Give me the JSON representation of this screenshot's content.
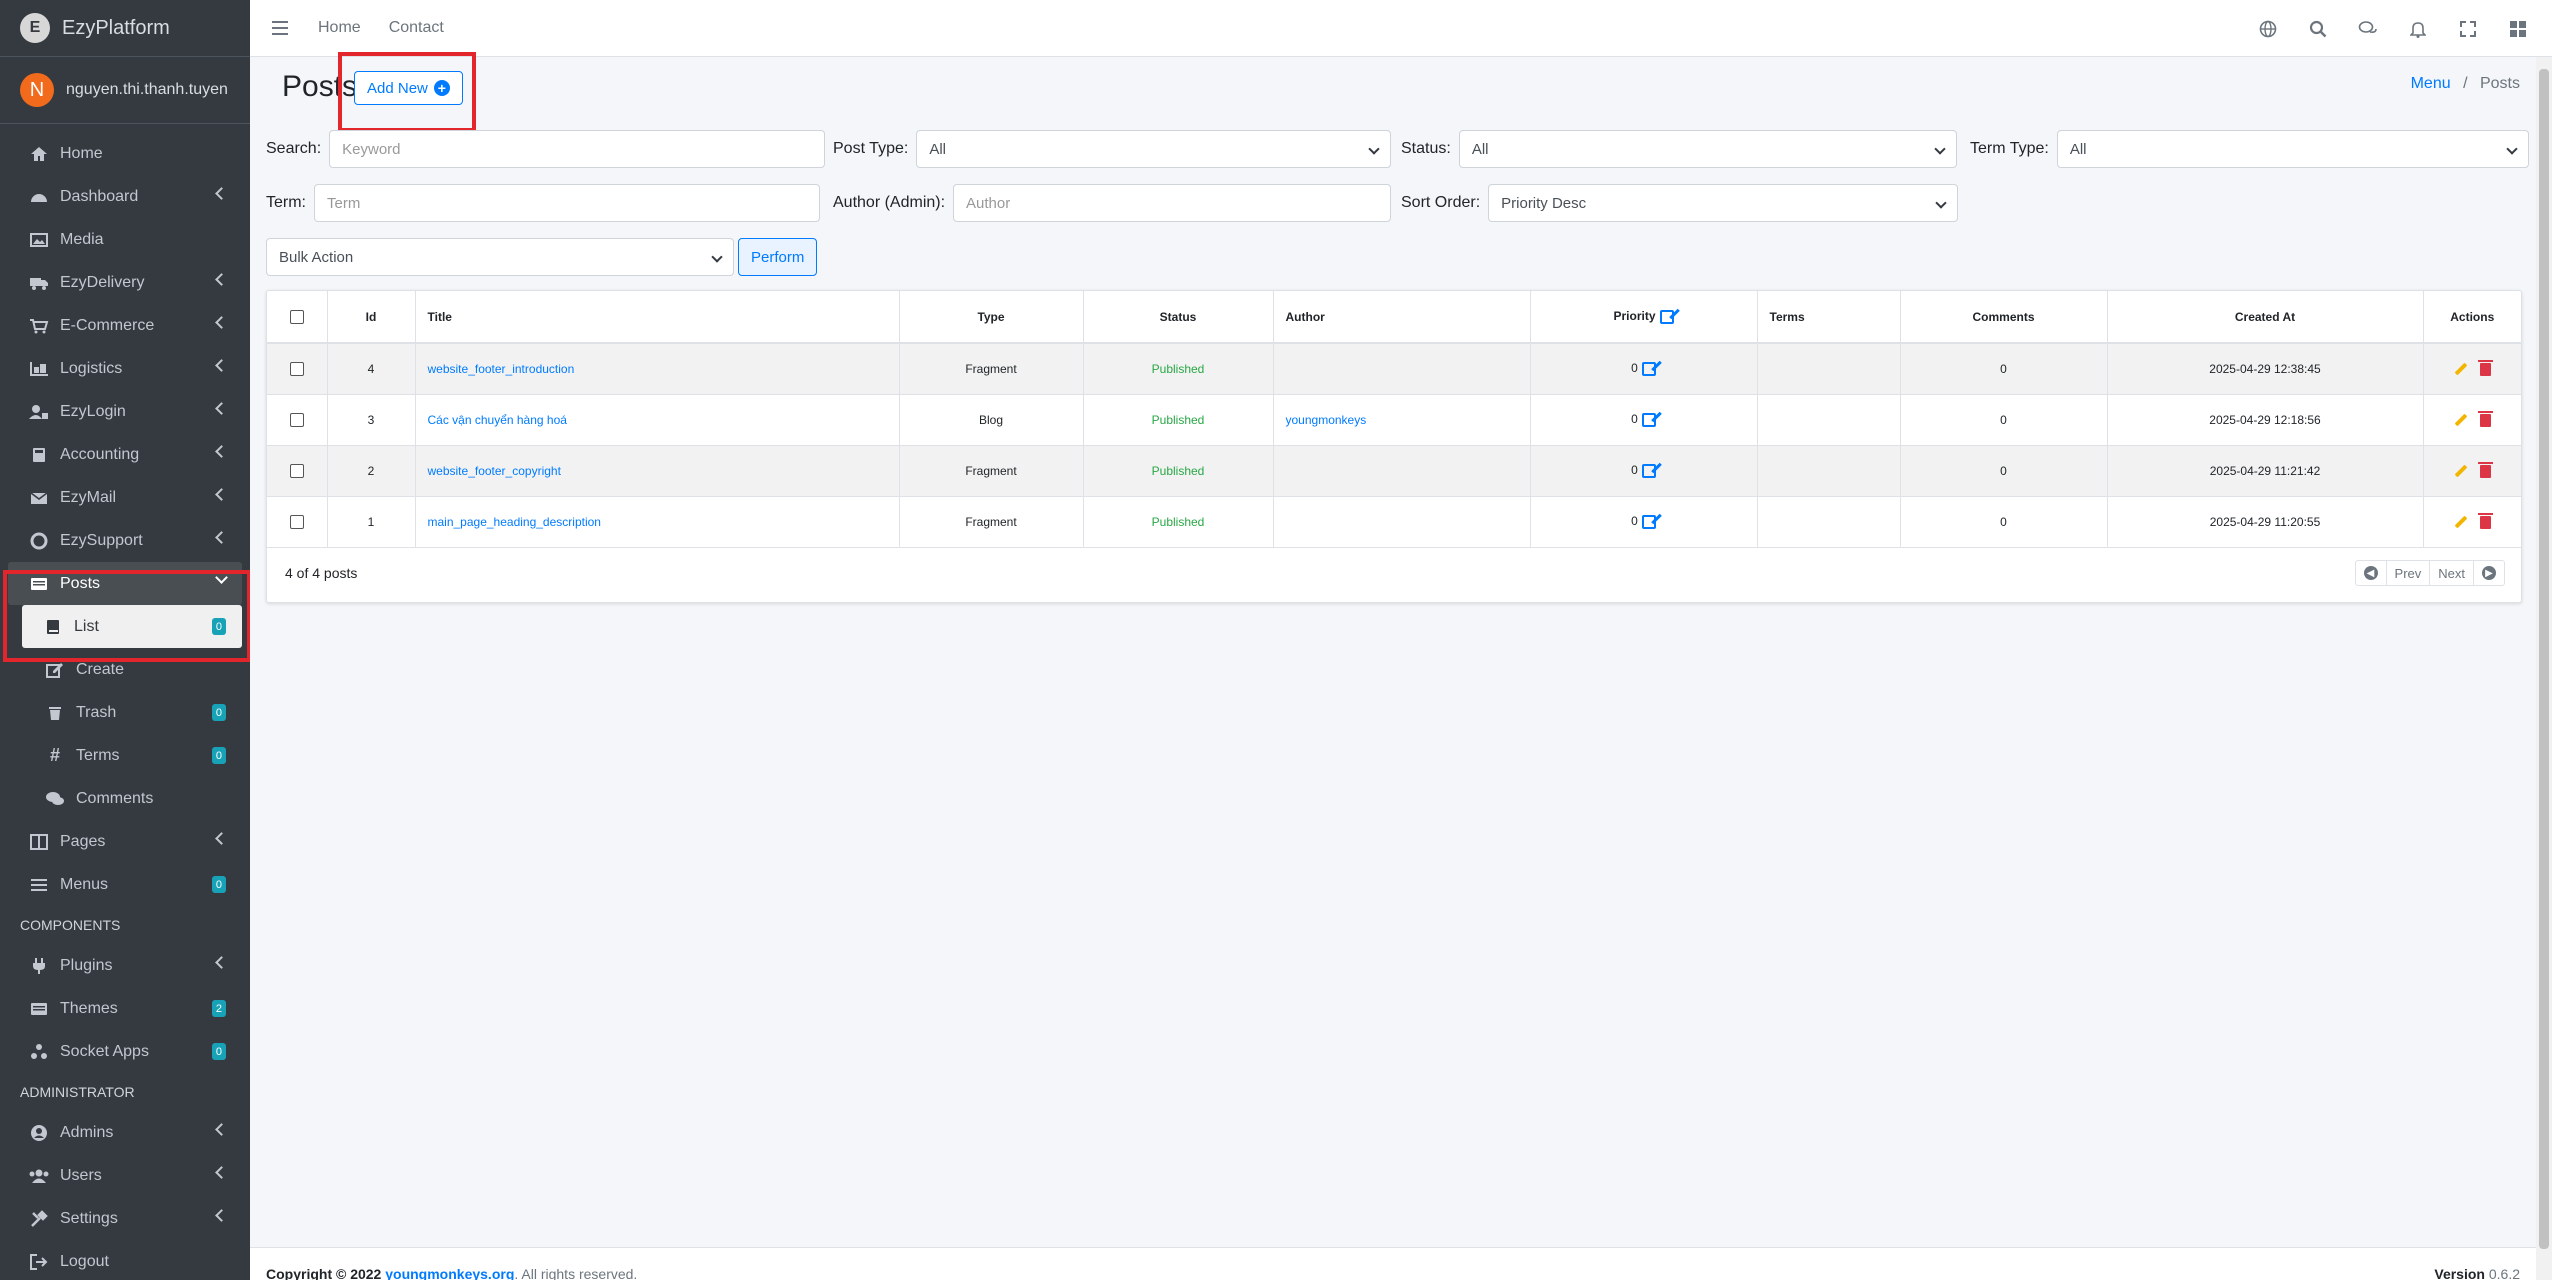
{
  "brand": {
    "logo_letter": "E",
    "name": "EzyPlatform"
  },
  "user": {
    "initial": "N",
    "name": "nguyen.thi.thanh.tuyen"
  },
  "sidebar": {
    "items": [
      {
        "label": "Home",
        "icon": "home-icon"
      },
      {
        "label": "Dashboard",
        "icon": "dashboard-icon"
      },
      {
        "label": "Media",
        "icon": "image-icon"
      },
      {
        "label": "EzyDelivery",
        "icon": "truck-icon"
      },
      {
        "label": "E-Commerce",
        "icon": "cart-icon"
      },
      {
        "label": "Logistics",
        "icon": "warehouse-icon"
      },
      {
        "label": "EzyLogin",
        "icon": "user-lock-icon"
      },
      {
        "label": "Accounting",
        "icon": "calculator-icon"
      },
      {
        "label": "EzyMail",
        "icon": "mail-icon"
      },
      {
        "label": "EzySupport",
        "icon": "support-icon"
      },
      {
        "label": "Posts",
        "icon": "posts-icon"
      },
      {
        "label": "List",
        "icon": "book-icon",
        "badge": "0"
      },
      {
        "label": "Create",
        "icon": "edit-icon"
      },
      {
        "label": "Trash",
        "icon": "trash-icon",
        "badge": "0"
      },
      {
        "label": "Terms",
        "icon": "hash-icon",
        "badge": "0"
      },
      {
        "label": "Comments",
        "icon": "comments-icon"
      },
      {
        "label": "Pages",
        "icon": "pages-icon"
      },
      {
        "label": "Menus",
        "icon": "menu-icon",
        "badge": "0"
      }
    ],
    "header_components": "COMPONENTS",
    "components": [
      {
        "label": "Plugins",
        "icon": "plug-icon"
      },
      {
        "label": "Themes",
        "icon": "themes-icon",
        "badge": "2"
      },
      {
        "label": "Socket Apps",
        "icon": "socket-icon",
        "badge": "0"
      }
    ],
    "header_admin": "ADMINISTRATOR",
    "admin": [
      {
        "label": "Admins",
        "icon": "admin-icon"
      },
      {
        "label": "Users",
        "icon": "users-icon"
      },
      {
        "label": "Settings",
        "icon": "settings-icon"
      },
      {
        "label": "Logout",
        "icon": "logout-icon"
      }
    ]
  },
  "topbar": {
    "home": "Home",
    "contact": "Contact"
  },
  "page": {
    "title": "Posts",
    "add_new": "Add New",
    "breadcrumb_menu": "Menu",
    "breadcrumb_sep": "/",
    "breadcrumb_current": "Posts"
  },
  "filters": {
    "search_label": "Search:",
    "search_placeholder": "Keyword",
    "post_type_label": "Post Type:",
    "post_type_value": "All",
    "status_label": "Status:",
    "status_value": "All",
    "term_type_label": "Term Type:",
    "term_type_value": "All",
    "term_label": "Term:",
    "term_placeholder": "Term",
    "author_label": "Author (Admin):",
    "author_placeholder": "Author",
    "sort_label": "Sort Order:",
    "sort_value": "Priority Desc",
    "bulk_value": "Bulk Action",
    "perform": "Perform"
  },
  "table": {
    "headers": {
      "id": "Id",
      "title": "Title",
      "type": "Type",
      "status": "Status",
      "author": "Author",
      "priority": "Priority",
      "terms": "Terms",
      "comments": "Comments",
      "created": "Created At",
      "actions": "Actions"
    },
    "rows": [
      {
        "id": "4",
        "title": "website_footer_introduction",
        "type": "Fragment",
        "status": "Published",
        "author": "",
        "priority": "0",
        "terms": "",
        "comments": "0",
        "created": "2025-04-29 12:38:45"
      },
      {
        "id": "3",
        "title": "Các vận chuyển hàng hoá",
        "type": "Blog",
        "status": "Published",
        "author": "youngmonkeys",
        "priority": "0",
        "terms": "",
        "comments": "0",
        "created": "2025-04-29 12:18:56"
      },
      {
        "id": "2",
        "title": "website_footer_copyright",
        "type": "Fragment",
        "status": "Published",
        "author": "",
        "priority": "0",
        "terms": "",
        "comments": "0",
        "created": "2025-04-29 11:21:42"
      },
      {
        "id": "1",
        "title": "main_page_heading_description",
        "type": "Fragment",
        "status": "Published",
        "author": "",
        "priority": "0",
        "terms": "",
        "comments": "0",
        "created": "2025-04-29 11:20:55"
      }
    ],
    "count": "4 of 4 posts",
    "prev": "Prev",
    "next": "Next"
  },
  "footer": {
    "copyright": "Copyright © 2022 ",
    "link": "youngmonkeys.org",
    "rest": ". All rights reserved.",
    "version_label": "Version",
    "version": "0.6.2"
  },
  "colors": {
    "sidebar_bg": "#343a40",
    "accent": "#007bff",
    "published": "#28a745",
    "highlight": "#e3262c",
    "badge": "#17a2b8"
  }
}
